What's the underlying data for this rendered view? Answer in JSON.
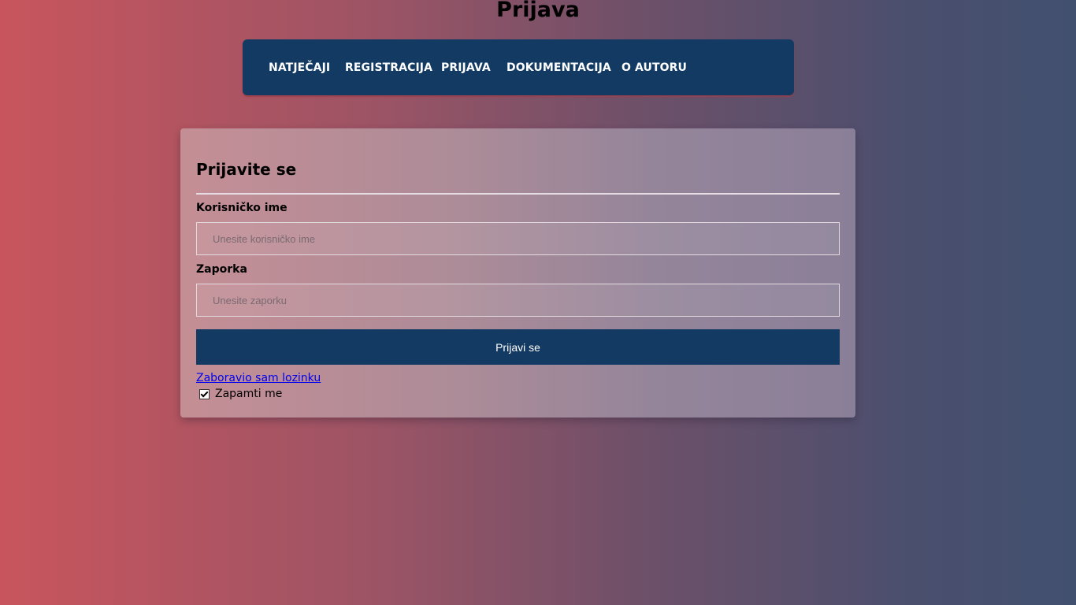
{
  "page": {
    "title": "Prijava"
  },
  "nav": {
    "items": [
      {
        "label": "NATJEČAJI"
      },
      {
        "label": "REGISTRACIJA"
      },
      {
        "label": "PRIJAVA"
      },
      {
        "label": "DOKUMENTACIJA"
      },
      {
        "label": "O AUTORU"
      }
    ]
  },
  "form": {
    "heading": "Prijavite se",
    "username": {
      "label": "Korisničko ime",
      "placeholder": "Unesite korisničko ime",
      "value": ""
    },
    "password": {
      "label": "Zaporka",
      "placeholder": "Unesite zaporku",
      "value": ""
    },
    "submit_label": "Prijavi se",
    "forgot_link": "Zaboravio sam lozinku",
    "remember": {
      "label": "Zapamti me",
      "checked": true
    }
  },
  "colors": {
    "navbar": "#123a62",
    "button": "#123a62",
    "link": "#0000ee"
  },
  "icons": {
    "checkbox": "check-icon"
  }
}
